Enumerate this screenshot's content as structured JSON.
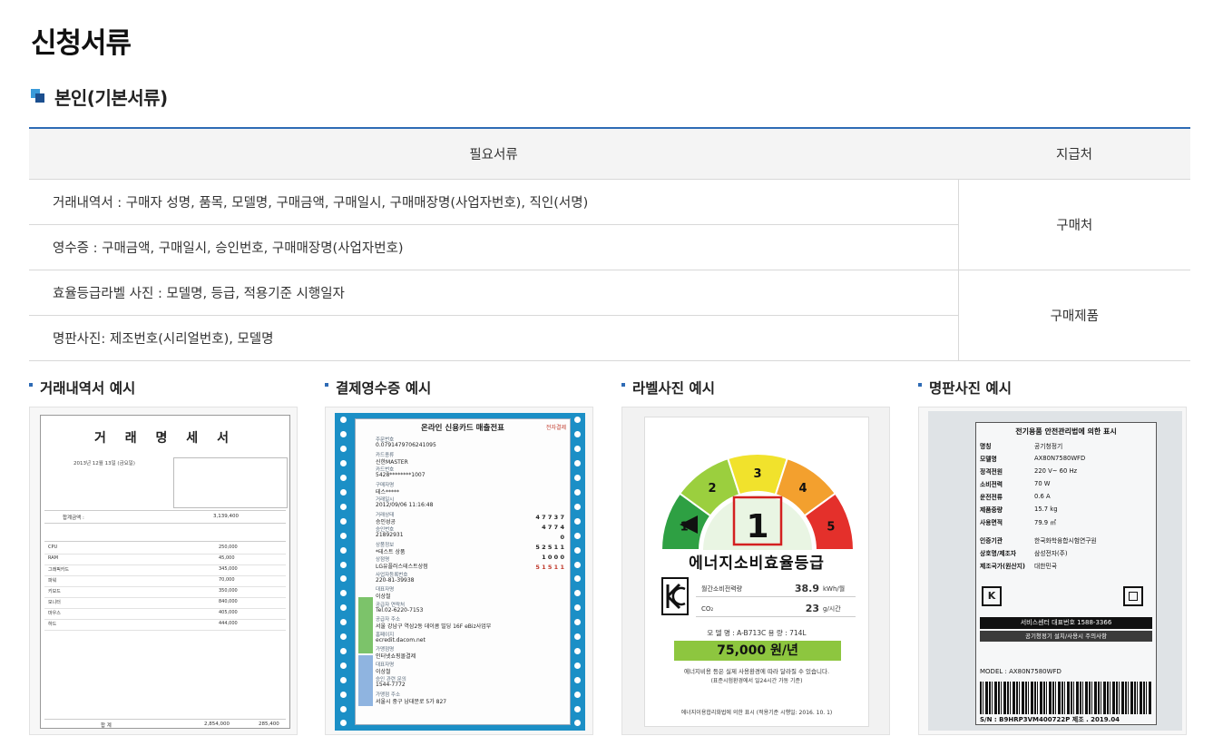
{
  "page_title": "신청서류",
  "section": {
    "title": "본인(기본서류)"
  },
  "table": {
    "headers": {
      "documents": "필요서류",
      "destination": "지급처"
    },
    "rows": [
      {
        "doc": "거래내역서 : 구매자 성명, 품목, 모델명, 구매금액, 구매일시, 구매매장명(사업자번호), 직인(서명)"
      },
      {
        "doc": "영수증 : 구매금액, 구매일시, 승인번호, 구매매장명(사업자번호)"
      },
      {
        "doc": "효율등급라벨 사진 : 모델명, 등급, 적용기준 시행일자"
      },
      {
        "doc": "명판사진: 제조번호(시리얼번호), 모델명"
      }
    ],
    "destinations": [
      "구매처",
      "구매제품"
    ]
  },
  "examples": [
    {
      "title": "거래내역서 예시"
    },
    {
      "title": "결제영수증 예시"
    },
    {
      "title": "라벨사진 예시"
    },
    {
      "title": "명판사진 예시"
    }
  ],
  "invoice_image": {
    "title": "거 래 명 세 서",
    "date": "2013년 12월 13일 (금요일)",
    "total_label": "합계금액 :",
    "total_amount": "3,139,400",
    "items": [
      {
        "name": "CPU",
        "amount": "250,000"
      },
      {
        "name": "RAM",
        "amount": "45,000"
      },
      {
        "name": "그래픽카드",
        "amount": "345,000"
      },
      {
        "name": "파워",
        "amount": "70,000"
      },
      {
        "name": "키보드",
        "amount": "350,000"
      },
      {
        "name": "모니터",
        "amount": "840,000"
      },
      {
        "name": "마우스",
        "amount": "405,000"
      },
      {
        "name": "하드",
        "amount": "444,000"
      }
    ],
    "sum_label": "합 계",
    "sum_amount": "2,854,000",
    "sum_tax": "285,400"
  },
  "slip_image": {
    "title": "온라인 신용카드 매출전표",
    "brand": "전자결제",
    "fields": [
      {
        "label": "주문번호",
        "value": "0.0791479706241095"
      },
      {
        "label": "카드종류",
        "value": "신한MASTER"
      },
      {
        "label": "카드번호",
        "value": "5428********1007"
      },
      {
        "label": "구매자명",
        "value": "테스*****"
      },
      {
        "label": "거래일시",
        "value": "2012/09/06 11:16:48"
      },
      {
        "label": "거래상태",
        "value": "승인성공"
      },
      {
        "label": "승인번호",
        "value": "21892931"
      },
      {
        "label": "상품정보",
        "value": "*테스트 상품"
      },
      {
        "label": "상점명",
        "value": "LG유플러스테스트상점"
      },
      {
        "label": "사업자등록번호",
        "value": "220-81-39938"
      },
      {
        "label": "대표자명",
        "value": "이상철"
      },
      {
        "label": "공급자 연락처",
        "value": "Tel.02-6220-7153"
      },
      {
        "label": "공급자 주소",
        "value": "서울 강남구 역삼2동 데이콤 빌딩 16F eBiz사업부"
      },
      {
        "label": "홈페이지",
        "value": "ecredit.dacom.net"
      },
      {
        "label": "가맹점명",
        "value": "인터넷쇼핑몰결제"
      },
      {
        "label": "대표자명",
        "value": "이상철"
      },
      {
        "label": "승인 관련 문의",
        "value": "1544-7772"
      },
      {
        "label": "가맹점 주소",
        "value": "서울시 중구 남대문로 5가 827"
      }
    ],
    "amounts": [
      "4 7 7 3 7",
      "4 7 7 4",
      "0",
      "5 2 5 1 1",
      "1 0 0 0",
      "5 1 5 1 1"
    ]
  },
  "label_image": {
    "grades": [
      "1",
      "2",
      "3",
      "4",
      "5"
    ],
    "current_grade": "1",
    "arc_colors": [
      "#2ea043",
      "#9bcf3e",
      "#f1e22c",
      "#f3a02e",
      "#e4302b"
    ],
    "grade_text": "에너지소비효율등급",
    "rows": [
      {
        "label": "월간소비전력량",
        "value": "38.9",
        "unit": "kWh/월"
      },
      {
        "label": "CO₂",
        "value": "23",
        "unit": "g/시간"
      }
    ],
    "model": "모 델 명 : A-B713C   용 량 : 714L",
    "cost": "75,000 원/년",
    "note1": "에너지비용 등은 실제 사용환경에 따라 달라질 수 있습니다.",
    "note2": "(표준시험환경에서 일24시간 가동 기준)",
    "footer": "에너지이용합리화법에 의한 표시 (적용기준 시행일: 2016. 10. 1)"
  },
  "plate_image": {
    "title": "전기용품 안전관리법에 의한 표시",
    "rows": [
      {
        "k": "명칭",
        "v": "공기청정기"
      },
      {
        "k": "모델명",
        "v": "AX80N7580WFD"
      },
      {
        "k": "정격전원",
        "v": "220 V~ 60 Hz"
      },
      {
        "k": "소비전력",
        "v": "70 W"
      },
      {
        "k": "운전전류",
        "v": "0.6 A"
      },
      {
        "k": "제품중량",
        "v": "15.7 kg"
      },
      {
        "k": "사용면적",
        "v": "79.9 ㎡"
      },
      {
        "k": "인증기관",
        "v": "한국화학융합시험연구원"
      },
      {
        "k": "상호명/제조자",
        "v": "삼성전자(주)"
      },
      {
        "k": "제조국가(원산지)",
        "v": "대한민국"
      }
    ],
    "service": "서비스센터 대표번호 1588-3366",
    "notice": "공기청정기 설치/사용시 주의사항",
    "model_line": "MODEL : AX80N7580WFD",
    "serial": "S/N : B9HRP3VM400722P    제조 . 2019.04"
  }
}
